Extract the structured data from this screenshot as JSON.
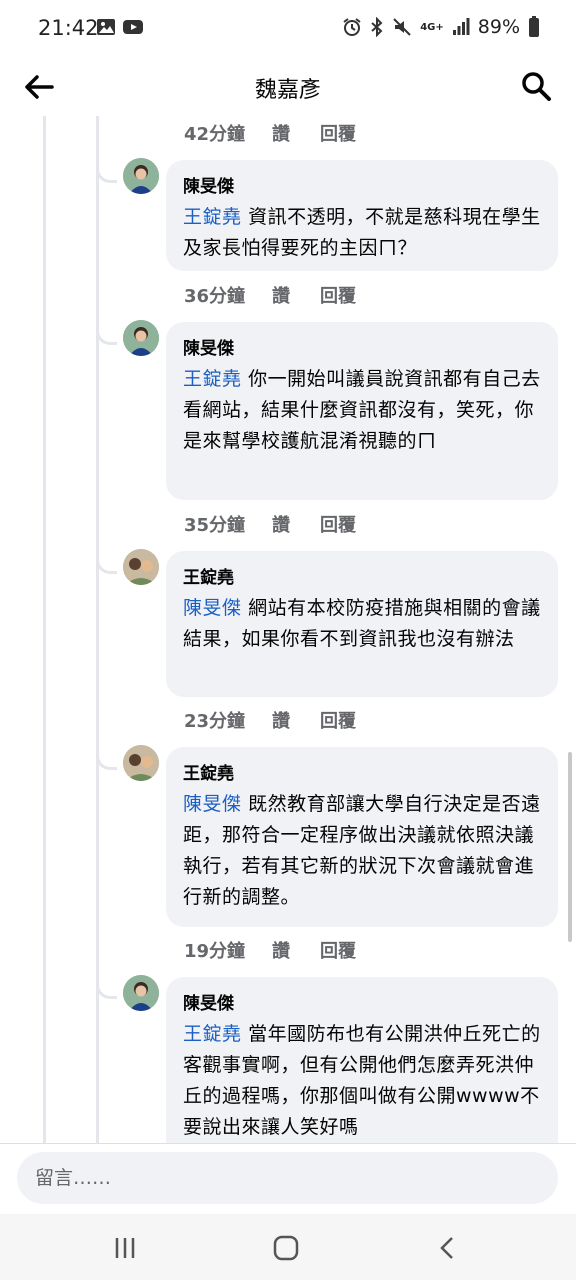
{
  "status_bar": {
    "time": "21:42",
    "battery": "89%",
    "network": "4G+",
    "icons": [
      "gallery-icon",
      "youtube-icon",
      "alarm-icon",
      "bluetooth-icon",
      "mute-icon",
      "signal-icon",
      "battery-icon"
    ]
  },
  "header": {
    "title": "魏嘉彥",
    "back_icon": "back-arrow-icon",
    "search_icon": "search-icon"
  },
  "actions": {
    "like": "讚",
    "reply": "回覆"
  },
  "top_meta": {
    "time": "42分鐘"
  },
  "comments": [
    {
      "author": "陳旻傑",
      "mention": "王錠堯",
      "text": "資訊不透明，不就是慈科現在學生及家長怕得要死的主因ㄇ？",
      "time": "36分鐘"
    },
    {
      "author": "陳旻傑",
      "mention": "王錠堯",
      "text": "你一開始叫議員說資訊都有自己去看網站，結果什麼資訊都沒有，笑死，你是來幫學校護航混淆視聽的ㄇ",
      "time": "35分鐘"
    },
    {
      "author": "王錠堯",
      "mention": "陳旻傑",
      "text": "網站有本校防疫措施與相關的會議結果，如果你看不到資訊我也沒有辦法",
      "time": "23分鐘"
    },
    {
      "author": "王錠堯",
      "mention": "陳旻傑",
      "text": "既然教育部讓大學自行決定是否遠距，那符合一定程序做出決議就依照決議執行，若有其它新的狀況下次會議就會進行新的調整。",
      "time": "19分鐘"
    },
    {
      "author": "陳旻傑",
      "mention": "王錠堯",
      "text": "當年國防布也有公開洪仲丘死亡的客觀事實啊，但有公開他們怎麼弄死洪仲丘的過程嗎，你那個叫做有公開wwww不要說出來讓人笑好嗎"
    }
  ],
  "composer": {
    "placeholder": "留言……"
  },
  "navbar": {
    "icons": [
      "recent-apps-icon",
      "home-icon",
      "back-nav-icon"
    ]
  }
}
